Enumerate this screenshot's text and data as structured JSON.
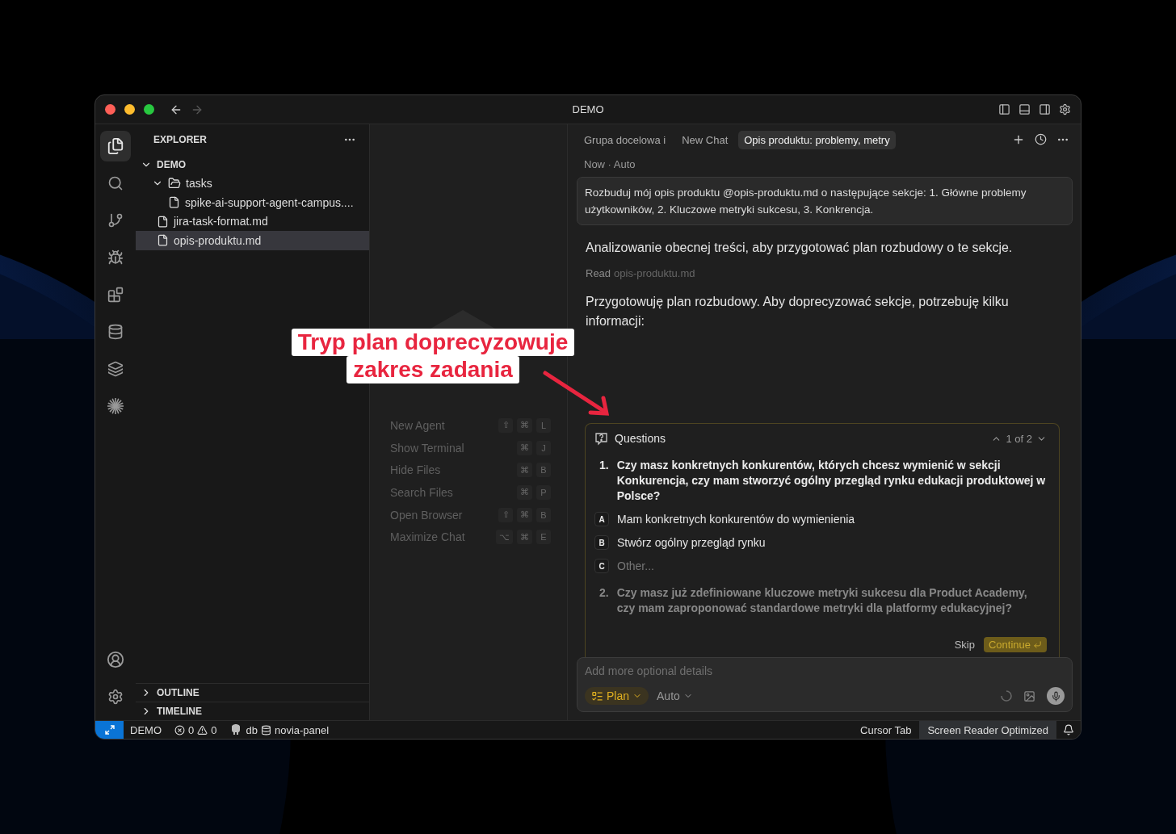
{
  "window": {
    "title": "DEMO"
  },
  "activity_bar": {
    "top": [
      {
        "kind": "files",
        "selected": true
      },
      {
        "kind": "search",
        "selected": false
      },
      {
        "kind": "branch",
        "selected": false
      },
      {
        "kind": "debug",
        "selected": false
      },
      {
        "kind": "blocks",
        "selected": false
      },
      {
        "kind": "database",
        "selected": false
      },
      {
        "kind": "layers",
        "selected": false
      },
      {
        "kind": "sparkle",
        "selected": false
      }
    ],
    "bottom": [
      {
        "kind": "account"
      },
      {
        "kind": "settings"
      }
    ]
  },
  "explorer": {
    "title": "EXPLORER",
    "tree": [
      {
        "label": "DEMO",
        "kind": "root",
        "expanded": true,
        "selected": false,
        "children": [
          {
            "label": "tasks",
            "kind": "folder",
            "expanded": true,
            "selected": false,
            "children": [
              {
                "label": "spike-ai-support-agent-campus....",
                "kind": "file",
                "selected": false
              }
            ]
          },
          {
            "label": "jira-task-format.md",
            "kind": "file",
            "selected": false
          },
          {
            "label": "opis-produktu.md",
            "kind": "file",
            "selected": true
          }
        ]
      }
    ],
    "panels": [
      {
        "label": "OUTLINE",
        "expanded": false
      },
      {
        "label": "TIMELINE",
        "expanded": false
      }
    ]
  },
  "shortcuts": [
    {
      "label": "New Agent",
      "keys": [
        "⇧",
        "⌘",
        "L"
      ]
    },
    {
      "label": "Show Terminal",
      "keys": [
        "⌘",
        "J"
      ]
    },
    {
      "label": "Hide Files",
      "keys": [
        "⌘",
        "B"
      ]
    },
    {
      "label": "Search Files",
      "keys": [
        "⌘",
        "P"
      ]
    },
    {
      "label": "Open Browser",
      "keys": [
        "⇧",
        "⌘",
        "B"
      ]
    },
    {
      "label": "Maximize Chat",
      "keys": [
        "⌥",
        "⌘",
        "E"
      ]
    }
  ],
  "chat": {
    "tabs": [
      {
        "label": "Grupa docelowa i",
        "selected": false
      },
      {
        "label": "New Chat",
        "selected": false
      },
      {
        "label": "Opis produktu: problemy, metry",
        "selected": true
      }
    ],
    "meta": "Now · Auto",
    "user_message": "Rozbuduj mój opis produktu @opis-produktu.md o następujące sekcje: 1. Główne problemy użytkowników, 2. Kluczowe metryki sukcesu, 3. Konkrencja.",
    "messages": [
      {
        "kind": "text",
        "text": "Analizowanie obecnej treści, aby przygotować plan rozbudowy o te sekcje."
      },
      {
        "kind": "read",
        "verb": "Read",
        "file": "opis-produktu.md"
      },
      {
        "kind": "text",
        "text": "Przygotowuję plan rozbudowy. Aby doprecyzować sekcje, potrzebuję kilku informacji:"
      }
    ],
    "questions": {
      "title": "Questions",
      "counter": "1 of 2",
      "items": [
        {
          "number": "1.",
          "text": "Czy masz konkretnych konkurentów, których chcesz wymienić w sekcji Konkurencja, czy mam stworzyć ogólny przegląd rynku edukacji produktowej w Polsce?",
          "active": true,
          "options": [
            {
              "letter": "A",
              "text": "Mam konkretnych konkurentów do wymienienia",
              "placeholder": false
            },
            {
              "letter": "B",
              "text": "Stwórz ogólny przegląd rynku",
              "placeholder": false
            },
            {
              "letter": "C",
              "text": "Other...",
              "placeholder": true
            }
          ]
        },
        {
          "number": "2.",
          "text": "Czy masz już zdefiniowane kluczowe metryki sukcesu dla Product Academy, czy mam zaproponować standardowe metryki dla platformy edukacyjnej?",
          "active": false
        }
      ],
      "skip": "Skip",
      "continue": "Continue"
    },
    "composer": {
      "placeholder": "Add more optional details",
      "mode": "Plan",
      "model": "Auto"
    }
  },
  "status_bar": {
    "workspace": "DEMO",
    "errors": "0",
    "warnings": "0",
    "db": "db",
    "connection": "novia-panel",
    "right": [
      {
        "label": "Cursor Tab",
        "selected": false
      },
      {
        "label": "Screen Reader Optimized",
        "selected": true
      }
    ]
  },
  "annotation": {
    "lines": [
      "Tryp plan doprecyzowuje",
      "zakres zadania"
    ]
  }
}
